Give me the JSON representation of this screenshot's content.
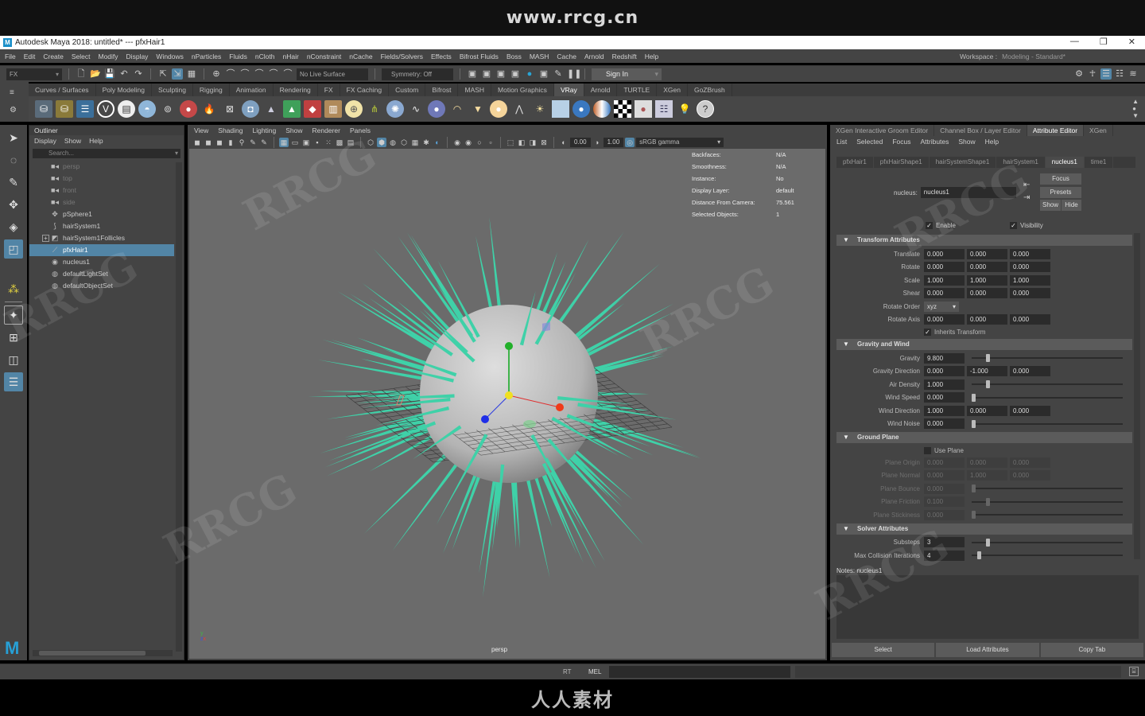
{
  "watermark_top": "www.rrcg.cn",
  "watermark_bottom": "人人素材",
  "watermark_tile": "RRCG",
  "window": {
    "title": "Autodesk Maya 2018: untitled*   ---   pfxHair1",
    "app_icon": "M",
    "controls": [
      "minimize-icon",
      "restore-icon",
      "close-icon"
    ]
  },
  "menubar": {
    "items": [
      "File",
      "Edit",
      "Create",
      "Select",
      "Modify",
      "Display",
      "Windows",
      "nParticles",
      "Fluids",
      "nCloth",
      "nHair",
      "nConstraint",
      "nCache",
      "Fields/Solvers",
      "Effects",
      "Bifrost Fluids",
      "Boss",
      "MASH",
      "Cache",
      "Arnold",
      "Redshift",
      "Help"
    ],
    "workspace_label": "Workspace :",
    "workspace_value": "Modeling - Standard*"
  },
  "statusline": {
    "menuset": "FX",
    "live_surface": "No Live Surface",
    "symmetry": "Symmetry: Off",
    "sign_in": "Sign In"
  },
  "shelf": {
    "tabs": [
      "Curves / Surfaces",
      "Poly Modeling",
      "Sculpting",
      "Rigging",
      "Animation",
      "Rendering",
      "FX",
      "FX Caching",
      "Custom",
      "Bifrost",
      "MASH",
      "Motion Graphics",
      "VRay",
      "Arnold",
      "TURTLE",
      "XGen",
      "GoZBrush"
    ],
    "active_tab": "VRay",
    "icons": [
      "vray-save-icon",
      "vray-open-icon",
      "vray-outliner-icon",
      "vray-logo-icon",
      "vray-doc-icon",
      "vray-dome-icon",
      "vray-camera-icon",
      "vray-material-icon",
      "vray-fire-icon",
      "vray-plane-icon",
      "vray-proxy-icon",
      "vray-cone-icon",
      "vray-fur-icon",
      "vray-mesh-icon",
      "vray-displacement-icon",
      "vray-sphere-light-icon",
      "vray-grass-icon",
      "vray-particle-icon",
      "vray-curve-icon",
      "vray-ball-icon",
      "vray-dome-light-icon",
      "vray-rect-light-icon",
      "vray-sphere-light2-icon",
      "vray-ies-icon",
      "vray-sun-icon",
      "vray-sky-icon",
      "vray-blue-sphere-icon",
      "vray-mtl-icon",
      "vray-checker-icon",
      "vray-vfb-icon",
      "vray-settings-icon",
      "vray-bulb-icon",
      "help-icon"
    ]
  },
  "toolbox": [
    "select-tool-icon",
    "lasso-tool-icon",
    "paint-select-icon",
    "move-tool-icon",
    "rotate-tool-icon",
    "scale-tool-icon",
    "soft-select-icon",
    "single-view-icon",
    "four-view-icon",
    "two-view-icon",
    "outliner-layout-icon"
  ],
  "outliner": {
    "title": "Outliner",
    "menu": [
      "Display",
      "Show",
      "Help"
    ],
    "search_placeholder": "Search...",
    "items": [
      {
        "label": "persp",
        "icon": "camera-icon",
        "dim": true
      },
      {
        "label": "top",
        "icon": "camera-icon",
        "dim": true
      },
      {
        "label": "front",
        "icon": "camera-icon",
        "dim": true
      },
      {
        "label": "side",
        "icon": "camera-icon",
        "dim": true
      },
      {
        "label": "pSphere1",
        "icon": "mesh-icon"
      },
      {
        "label": "hairSystem1",
        "icon": "hair-system-icon"
      },
      {
        "label": "hairSystem1Follicles",
        "icon": "follicles-icon",
        "expandable": true
      },
      {
        "label": "pfxHair1",
        "icon": "pfx-hair-icon",
        "selected": true
      },
      {
        "label": "nucleus1",
        "icon": "nucleus-icon"
      },
      {
        "label": "defaultLightSet",
        "icon": "set-icon"
      },
      {
        "label": "defaultObjectSet",
        "icon": "set-icon"
      }
    ]
  },
  "viewport": {
    "menu": [
      "View",
      "Shading",
      "Lighting",
      "Show",
      "Renderer",
      "Panels"
    ],
    "exposure": "0.00",
    "gamma": "1.00",
    "color_space": "sRGB gamma",
    "camera_name": "persp",
    "hud": [
      {
        "k": "Backfaces:",
        "v": "N/A"
      },
      {
        "k": "Smoothness:",
        "v": "N/A"
      },
      {
        "k": "Instance:",
        "v": "No"
      },
      {
        "k": "Display Layer:",
        "v": "default"
      },
      {
        "k": "Distance From Camera:",
        "v": "75.561"
      },
      {
        "k": "Selected Objects:",
        "v": "1"
      }
    ],
    "hair_color": "#3fd1a8",
    "sphere_color": "#c8c8c8"
  },
  "attribute_editor": {
    "panel_tabs": [
      "XGen Interactive Groom Editor",
      "Channel Box / Layer Editor",
      "Attribute Editor",
      "XGen"
    ],
    "active_panel_tab": "Attribute Editor",
    "menu": [
      "List",
      "Selected",
      "Focus",
      "Attributes",
      "Show",
      "Help"
    ],
    "node_tabs": [
      "pfxHair1",
      "pfxHairShape1",
      "hairSystemShape1",
      "hairSystem1",
      "nucleus1",
      "time1"
    ],
    "active_node_tab": "nucleus1",
    "node_label": "nucleus:",
    "node_value": "nucleus1",
    "buttons": {
      "focus": "Focus",
      "presets": "Presets",
      "show": "Show",
      "hide": "Hide"
    },
    "enable_label": "Enable",
    "visibility_label": "Visibility",
    "sections": {
      "transform": {
        "title": "Transform Attributes",
        "translate": [
          "0.000",
          "0.000",
          "0.000"
        ],
        "rotate": [
          "0.000",
          "0.000",
          "0.000"
        ],
        "scale": [
          "1.000",
          "1.000",
          "1.000"
        ],
        "shear": [
          "0.000",
          "0.000",
          "0.000"
        ],
        "rotate_order": "xyz",
        "rotate_axis": [
          "0.000",
          "0.000",
          "0.000"
        ],
        "inherits_transform": "Inherits Transform",
        "labels": [
          "Translate",
          "Rotate",
          "Scale",
          "Shear",
          "Rotate Order",
          "Rotate Axis"
        ]
      },
      "gravity": {
        "title": "Gravity and Wind",
        "labels": [
          "Gravity",
          "Gravity Direction",
          "Air Density",
          "Wind Speed",
          "Wind Direction",
          "Wind Noise"
        ],
        "gravity": "9.800",
        "gravity_slider": 0.1,
        "gravity_direction": [
          "0.000",
          "-1.000",
          "0.000"
        ],
        "air_density": "1.000",
        "air_density_slider": 0.1,
        "wind_speed": "0.000",
        "wind_speed_slider": 0,
        "wind_direction": [
          "1.000",
          "0.000",
          "0.000"
        ],
        "wind_noise": "0.000",
        "wind_noise_slider": 0
      },
      "ground": {
        "title": "Ground Plane",
        "use_plane": "Use Plane",
        "labels": [
          "Plane Origin",
          "Plane Normal",
          "Plane Bounce",
          "Plane Friction",
          "Plane Stickiness"
        ],
        "plane_origin": [
          "0.000",
          "0.000",
          "0.000"
        ],
        "plane_normal": [
          "0.000",
          "1.000",
          "0.000"
        ],
        "plane_bounce": "0.000",
        "plane_bounce_slider": 0,
        "plane_friction": "0.100",
        "plane_friction_slider": 0.1,
        "plane_stickiness": "0.000",
        "plane_stickiness_slider": 0
      },
      "solver": {
        "title": "Solver Attributes",
        "labels": [
          "Substeps",
          "Max Collision Iterations"
        ],
        "substeps": "3",
        "substeps_slider": 0.1,
        "max_collision_iterations": "4",
        "max_collision_iterations_slider": 0.04
      }
    },
    "notes_label": "Notes:  nucleus1",
    "bottom_buttons": [
      "Select",
      "Load Attributes",
      "Copy Tab"
    ]
  },
  "cmdline": {
    "rt_label": "RT",
    "lang": "MEL"
  }
}
